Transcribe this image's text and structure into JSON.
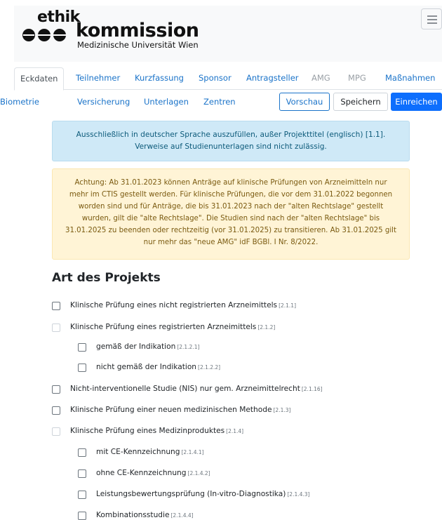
{
  "header": {
    "logo_top": "ethik",
    "logo_main": "kommission",
    "logo_sub": "Medizinische Universität Wien"
  },
  "tabs": [
    {
      "label": "Eckdaten",
      "active": true
    },
    {
      "label": "Teilnehmer"
    },
    {
      "label": "Kurzfassung"
    },
    {
      "label": "Sponsor"
    },
    {
      "label": "Antragsteller"
    },
    {
      "label": "AMG",
      "disabled": true
    },
    {
      "label": "MPG",
      "disabled": true
    },
    {
      "label": "Maßnahmen"
    },
    {
      "label": "Biometrie"
    },
    {
      "label": "Versicherung"
    },
    {
      "label": "Unterlagen"
    },
    {
      "label": "Zentren"
    }
  ],
  "actions": {
    "preview": "Vorschau",
    "save": "Speichern",
    "submit": "Einreichen"
  },
  "alerts": {
    "info_line1": "Ausschließlich in deutscher Sprache auszufüllen, außer Projekttitel (englisch) [1.1].",
    "info_line2": "Verweise auf Studienunterlagen sind nicht zulässig.",
    "warn_lines": [
      "Achtung: Ab 31.01.2023 können Anträge auf klinische Prüfungen von Arzneimitteln nur",
      "mehr im CTIS gestellt werden. Für klinische Prüfungen, die vor dem 31.01.2022 begonnen",
      "worden sind und für Anträge, die bis 31.01.2023 nach der \"alten Rechtslage\" gestellt",
      "wurden, gilt die \"alte Rechtslage\". Die Studien sind nach der \"alten Rechtslage\" bis",
      "31.01.2025 zu beenden oder rechtzeitig (vor 31.01.2025) zu transitieren. Ab 31.01.2025 gilt",
      "nur mehr das \"neue AMG\" idF BGBl. I Nr. 8/2022."
    ]
  },
  "section": {
    "title": "Art des Projekts",
    "options": [
      {
        "label": "Klinische Prüfung eines nicht registrierten Arzneimittels",
        "ref": "[2.1.1]",
        "indent": 0,
        "disabled": false
      },
      {
        "label": "Klinische Prüfung eines registrierten Arzneimittels",
        "ref": "[2.1.2]",
        "indent": 0,
        "disabled": true
      },
      {
        "label": "gemäß der Indikation",
        "ref": "[2.1.2.1]",
        "indent": 1,
        "disabled": false
      },
      {
        "label": "nicht gemäß der Indikation",
        "ref": "[2.1.2.2]",
        "indent": 1,
        "disabled": false
      },
      {
        "label": "Nicht-interventionelle Studie (NIS) nur gem. Arzneimittelrecht",
        "ref": "[2.1.16]",
        "indent": 0,
        "disabled": false
      },
      {
        "label": "Klinische Prüfung einer neuen medizinischen Methode",
        "ref": "[2.1.3]",
        "indent": 0,
        "disabled": false
      },
      {
        "label": "Klinische Prüfung eines Medizinproduktes",
        "ref": "[2.1.4]",
        "indent": 0,
        "disabled": true
      },
      {
        "label": "mit CE-Kennzeichnung",
        "ref": "[2.1.4.1]",
        "indent": 1,
        "disabled": false
      },
      {
        "label": "ohne CE-Kennzeichnung",
        "ref": "[2.1.4.2]",
        "indent": 1,
        "disabled": false
      },
      {
        "label": "Leistungsbewertungsprüfung (In-vitro-Diagnostika)",
        "ref": "[2.1.4.3]",
        "indent": 1,
        "disabled": false
      },
      {
        "label": "Kombinationsstudie",
        "ref": "[2.1.4.4]",
        "indent": 1,
        "disabled": false
      }
    ]
  },
  "colors": {
    "link": "#1a73c9",
    "primary": "#0d6efd",
    "info_bg": "#cfe9f7",
    "warn_bg": "#fff4d6"
  }
}
